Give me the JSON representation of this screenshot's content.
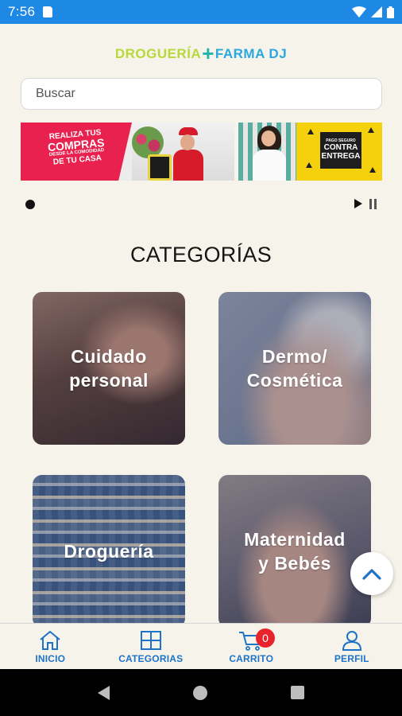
{
  "status_bar": {
    "time": "7:56"
  },
  "header": {
    "logo_part1": "DROGUERÍA",
    "logo_plus": "+",
    "logo_part2": "FARMA DJ"
  },
  "search": {
    "placeholder": "Buscar"
  },
  "banner": {
    "slide1": {
      "line1": "REALIZA TUS",
      "line2": "COMPRAS",
      "line3": "DESDE LA COMODIDAD",
      "line4": "DE TU CASA"
    },
    "slide2": {
      "tag_small": "PAGO SEGURO",
      "tag_line1": "CONTRA",
      "tag_line2": "ENTREGA"
    }
  },
  "section": {
    "title": "CATEGORÍAS"
  },
  "categories": [
    {
      "line1": "Cuidado",
      "line2": "personal"
    },
    {
      "line1": "Dermo/",
      "line2": "Cosmética"
    },
    {
      "line1": "Droguería",
      "line2": ""
    },
    {
      "line1": "Maternidad",
      "line2": "y Bebés"
    }
  ],
  "bottom_nav": [
    {
      "label": "INICIO",
      "icon": "home-icon"
    },
    {
      "label": "CATEGORIAS",
      "icon": "grid-icon"
    },
    {
      "label": "CARRITO",
      "icon": "cart-icon",
      "badge": "0"
    },
    {
      "label": "PERFIL",
      "icon": "user-icon"
    }
  ],
  "colors": {
    "primary": "#1e73c8",
    "status_bar": "#1e88e5",
    "badge": "#e8232b",
    "background": "#f6f4ea"
  }
}
